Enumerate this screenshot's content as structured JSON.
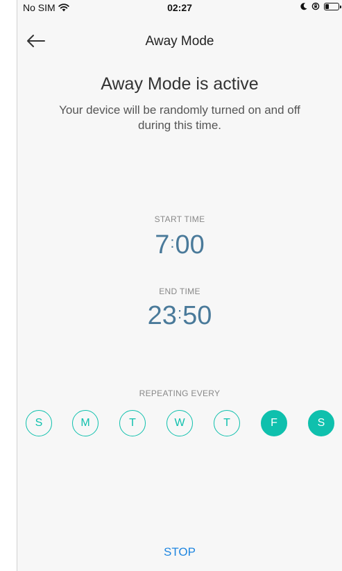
{
  "status_bar": {
    "carrier": "No SIM",
    "time": "02:27",
    "battery_level": 0.3
  },
  "nav": {
    "title": "Away Mode"
  },
  "headline": "Away Mode is active",
  "subtitle": "Your device will be randomly turned on and off during this time.",
  "start": {
    "label": "START TIME",
    "hour": "7",
    "minute": "00"
  },
  "end": {
    "label": "END TIME",
    "hour": "23",
    "minute": "50"
  },
  "repeat": {
    "label": "REPEATING EVERY",
    "days": [
      {
        "letter": "S",
        "selected": false
      },
      {
        "letter": "M",
        "selected": false
      },
      {
        "letter": "T",
        "selected": false
      },
      {
        "letter": "W",
        "selected": false
      },
      {
        "letter": "T",
        "selected": false
      },
      {
        "letter": "F",
        "selected": true
      },
      {
        "letter": "S",
        "selected": true
      }
    ]
  },
  "stop_label": "STOP",
  "colors": {
    "accent": "#0fc0ad",
    "time": "#4a7a9a",
    "link": "#1f86e0"
  }
}
